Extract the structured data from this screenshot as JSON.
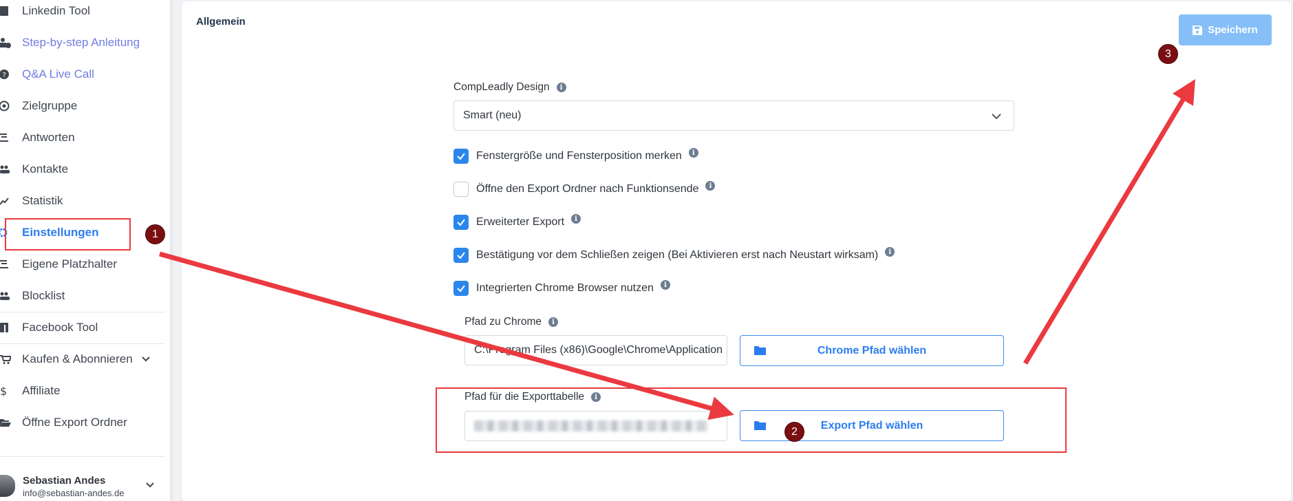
{
  "sidebar": {
    "items": [
      {
        "label": "Linkedin Tool",
        "icon": "linkedin-icon",
        "style": "normal"
      },
      {
        "label": "Step-by-step Anleitung",
        "icon": "guide-icon",
        "style": "link"
      },
      {
        "label": "Q&A Live Call",
        "icon": "question-icon",
        "style": "link"
      },
      {
        "label": "Zielgruppe",
        "icon": "target-icon",
        "style": "normal"
      },
      {
        "label": "Antworten",
        "icon": "answers-icon",
        "style": "normal"
      },
      {
        "label": "Kontakte",
        "icon": "contacts-icon",
        "style": "normal"
      },
      {
        "label": "Statistik",
        "icon": "chart-icon",
        "style": "normal"
      },
      {
        "label": "Einstellungen",
        "icon": "gear-icon",
        "style": "active"
      },
      {
        "label": "Eigene Platzhalter",
        "icon": "placeholder-icon",
        "style": "normal"
      },
      {
        "label": "Blocklist",
        "icon": "block-users-icon",
        "style": "normal"
      },
      {
        "label": "Facebook Tool",
        "icon": "facebook-icon",
        "style": "normal"
      },
      {
        "label": "Kaufen & Abonnieren",
        "icon": "cart-icon",
        "style": "normal"
      },
      {
        "label": "Affiliate",
        "icon": "dollar-icon",
        "style": "normal"
      },
      {
        "label": "Öffne Export Ordner",
        "icon": "folder-open-icon",
        "style": "normal"
      }
    ],
    "user": {
      "name": "Sebastian Andes",
      "email": "info@sebastian-andes.de"
    }
  },
  "main": {
    "title": "Allgemein",
    "save_label": "Speichern",
    "design": {
      "label": "CompLeadly Design",
      "value": "Smart (neu)"
    },
    "checkboxes": [
      {
        "label": "Fenstergröße und Fensterposition merken",
        "checked": true
      },
      {
        "label": "Öffne den Export Ordner nach Funktionsende",
        "checked": false
      },
      {
        "label": "Erweiterter Export",
        "checked": true
      },
      {
        "label": "Bestätigung vor dem Schließen zeigen (Bei Aktivieren erst nach Neustart wirksam)",
        "checked": true
      },
      {
        "label": "Integrierten Chrome Browser nutzen",
        "checked": true
      }
    ],
    "chrome_path": {
      "label": "Pfad zu Chrome",
      "value": "C:\\Program Files (x86)\\Google\\Chrome\\Application",
      "button": "Chrome Pfad wählen"
    },
    "export_path": {
      "label": "Pfad für die Exporttabelle",
      "button": "Export Pfad wählen"
    }
  },
  "annotations": {
    "badges": [
      "1",
      "2",
      "3"
    ],
    "color": "#ea3a3f",
    "badge_color": "#7a0f12"
  },
  "colors": {
    "accent": "#2b7ded",
    "link": "#6f7ce0",
    "save_button": "#86bff7",
    "checkbox": "#2b86ea"
  }
}
